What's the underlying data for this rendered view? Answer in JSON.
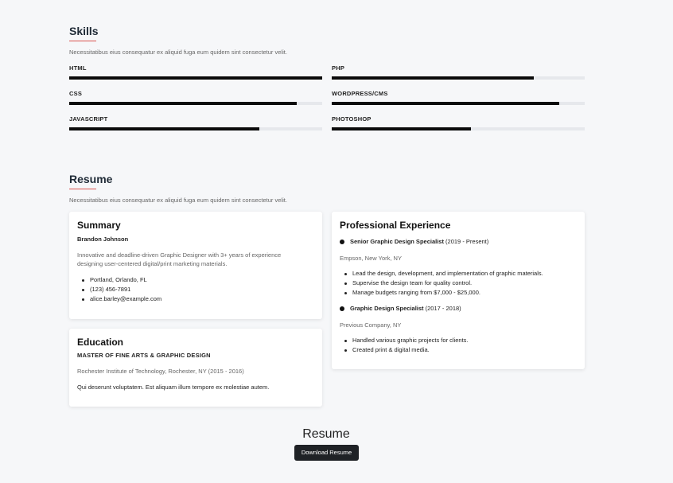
{
  "skills_section": {
    "title": "Skills",
    "description": "Necessitatibus eius consequatur ex aliquid fuga eum quidem sint consectetur velit.",
    "items": [
      {
        "name": "HTML",
        "level": 1.0
      },
      {
        "name": "PHP",
        "level": 0.8
      },
      {
        "name": "CSS",
        "level": 0.9
      },
      {
        "name": "WORDPRESS/CMS",
        "level": 0.9
      },
      {
        "name": "JAVASCRIPT",
        "level": 0.75
      },
      {
        "name": "PHOTOSHOP",
        "level": 0.55
      }
    ]
  },
  "resume_section": {
    "title": "Resume",
    "description": "Necessitatibus eius consequatur ex aliquid fuga eum quidem sint consectetur velit.",
    "summary": {
      "heading": "Summary",
      "name": "Brandon Johnson",
      "text": "Innovative and deadline-driven Graphic Designer with 3+ years of experience designing user-centered digital/print marketing materials.",
      "contacts": [
        "Portland, Orlando, FL",
        "(123) 456-7891",
        "alice.barley@example.com"
      ]
    },
    "education": {
      "heading": "Education",
      "degree": "MASTER OF FINE ARTS & GRAPHIC DESIGN",
      "school": "Rochester Institute of Technology, Rochester, NY (2015 - 2016)",
      "text": "Qui deserunt voluptatem. Est aliquam illum tempore ex molestiae autem."
    },
    "experience": {
      "heading": "Professional Experience",
      "jobs": [
        {
          "title": "Senior Graphic Design Specialist",
          "period": "(2019 - Present)",
          "company": "Empson, New York, NY",
          "duties": [
            "Lead the design, development, and implementation of graphic materials.",
            "Supervise the design team for quality control.",
            "Manage budgets ranging from $7,000 - $25,000."
          ]
        },
        {
          "title": "Graphic Design Specialist",
          "period": "(2017 - 2018)",
          "company": "Previous Company, NY",
          "duties": [
            "Handled various graphic projects for clients.",
            "Created print & digital media."
          ]
        }
      ]
    }
  },
  "footer": {
    "title": "Resume",
    "download_label": "Download Resume"
  }
}
